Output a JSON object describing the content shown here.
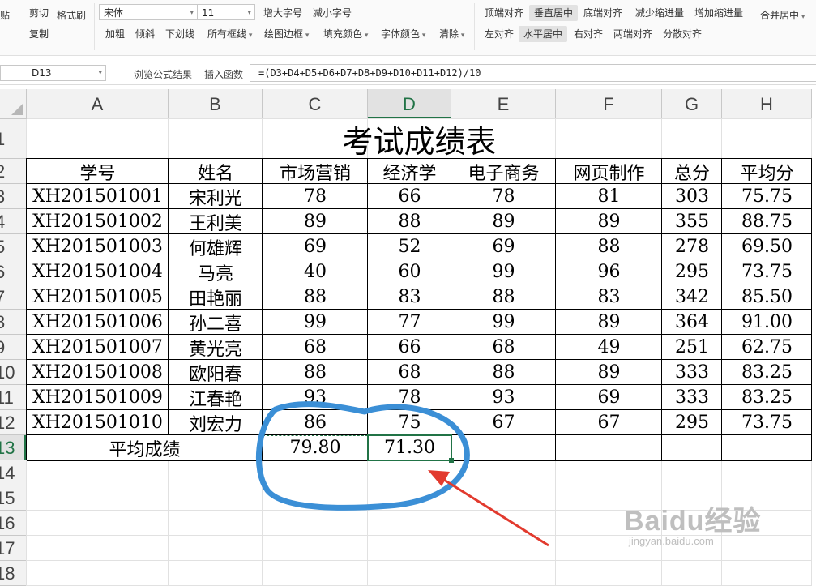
{
  "ribbon": {
    "paste": "贴",
    "cut": "剪切",
    "format_painter": "格式刷",
    "copy": "复制",
    "font_name": "宋体",
    "font_size": "11",
    "increase_font": "增大字号",
    "decrease_font": "减小字号",
    "bold": "加粗",
    "italic": "倾斜",
    "underline": "下划线",
    "all_borders": "所有框线",
    "draw_border": "绘图边框",
    "fill_color": "填充颜色",
    "font_color": "字体颜色",
    "clear": "清除",
    "align_top": "顶端对齐",
    "align_middle": "垂直居中",
    "align_bottom": "底端对齐",
    "decrease_indent": "减少缩进量",
    "increase_indent": "增加缩进量",
    "merge_center": "合并居中",
    "align_left": "左对齐",
    "align_center": "水平居中",
    "align_right": "右对齐",
    "justify": "两端对齐",
    "distributed": "分散对齐"
  },
  "formula_bar": {
    "name_box": "D13",
    "browse_result": "浏览公式结果",
    "insert_function": "插入函数",
    "formula": "=(D3+D4+D5+D6+D7+D8+D9+D10+D11+D12)/10"
  },
  "columns": [
    "A",
    "B",
    "C",
    "D",
    "E",
    "F",
    "G",
    "H"
  ],
  "rows": [
    "1",
    "2",
    "3",
    "4",
    "5",
    "6",
    "7",
    "8",
    "9",
    "10",
    "11",
    "12",
    "13",
    "14",
    "15",
    "16",
    "17",
    "18"
  ],
  "active_cell": "D13",
  "sheet": {
    "title": "考试成绩表",
    "headers": [
      "学号",
      "姓名",
      "市场营销",
      "经济学",
      "电子商务",
      "网页制作",
      "总分",
      "平均分"
    ],
    "records": [
      [
        "XH201501001",
        "宋利光",
        "78",
        "66",
        "78",
        "81",
        "303",
        "75.75"
      ],
      [
        "XH201501002",
        "王利美",
        "89",
        "88",
        "89",
        "89",
        "355",
        "88.75"
      ],
      [
        "XH201501003",
        "何雄辉",
        "69",
        "52",
        "69",
        "88",
        "278",
        "69.50"
      ],
      [
        "XH201501004",
        "马亮",
        "40",
        "60",
        "99",
        "96",
        "295",
        "73.75"
      ],
      [
        "XH201501005",
        "田艳丽",
        "88",
        "83",
        "88",
        "83",
        "342",
        "85.50"
      ],
      [
        "XH201501006",
        "孙二喜",
        "99",
        "77",
        "99",
        "89",
        "364",
        "91.00"
      ],
      [
        "XH201501007",
        "黄光亮",
        "68",
        "66",
        "68",
        "49",
        "251",
        "62.75"
      ],
      [
        "XH201501008",
        "欧阳春",
        "88",
        "68",
        "88",
        "89",
        "333",
        "83.25"
      ],
      [
        "XH201501009",
        "江春艳",
        "93",
        "78",
        "93",
        "69",
        "333",
        "83.25"
      ],
      [
        "XH201501010",
        "刘宏力",
        "86",
        "75",
        "67",
        "67",
        "295",
        "73.75"
      ]
    ],
    "avg_label": "平均成绩",
    "avg_c": "79.80",
    "avg_d": "71.30"
  },
  "watermark": {
    "brand": "Baidu经验",
    "site": "jingyan.baidu.com"
  },
  "colors": {
    "selection": "#217346",
    "annotation_circle": "#3b8fd6",
    "annotation_arrow": "#e23a2e"
  }
}
